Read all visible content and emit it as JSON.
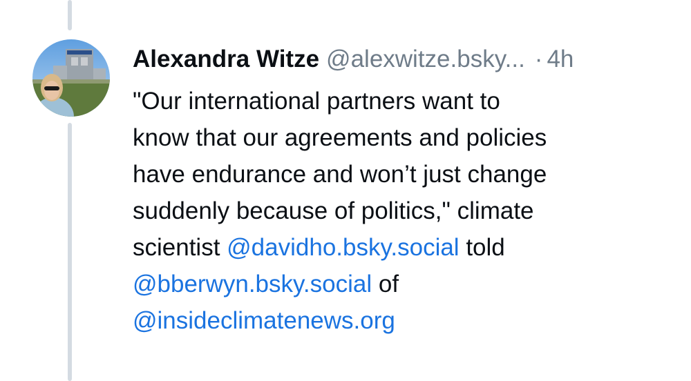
{
  "author": {
    "display_name": "Alexandra Witze",
    "handle": "@alexwitze.bsky...",
    "separator": "·",
    "timestamp": "4h"
  },
  "post": {
    "lines": {
      "l1": "\"Our international partners want to",
      "l2": "know that our agreements and policies",
      "l3": "have endurance and won’t just change",
      "l4": "suddenly because of politics,\" climate",
      "l5_pre": "scientist ",
      "l5_mention": "@davidho.bsky.social",
      "l5_post": " told",
      "l6_mention": "@bberwyn.bsky.social",
      "l6_post": " of",
      "l7_mention": "@insideclimatenews.org"
    }
  },
  "colors": {
    "text": "#0b0f14",
    "muted": "#6f7c89",
    "link": "#1a73e0",
    "thread_line": "#d4dbe2"
  },
  "icons": {
    "avatar": "user-photo-avatar"
  }
}
